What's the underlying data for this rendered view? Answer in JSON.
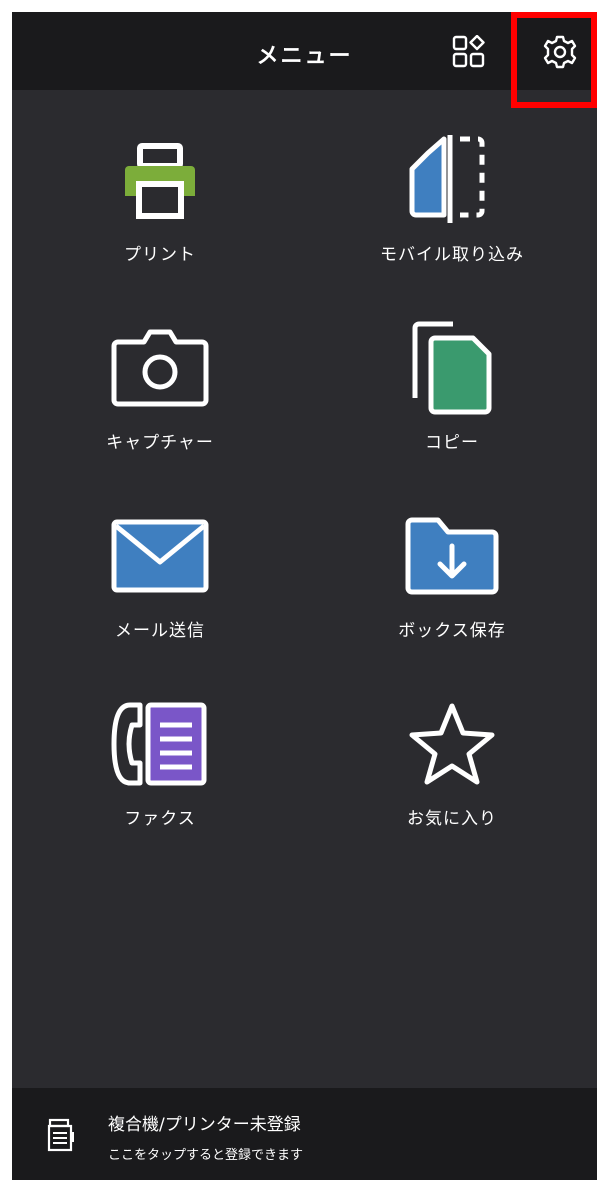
{
  "header": {
    "title": "メニュー",
    "icons": {
      "layout": "grid-shapes-icon",
      "settings": "gear-icon"
    }
  },
  "menu": {
    "items": [
      {
        "label": "プリント",
        "icon": "printer-icon"
      },
      {
        "label": "モバイル取り込み",
        "icon": "mobile-import-icon"
      },
      {
        "label": "キャプチャー",
        "icon": "camera-icon"
      },
      {
        "label": "コピー",
        "icon": "copy-documents-icon"
      },
      {
        "label": "メール送信",
        "icon": "mail-icon"
      },
      {
        "label": "ボックス保存",
        "icon": "box-folder-download-icon"
      },
      {
        "label": "ファクス",
        "icon": "fax-icon"
      },
      {
        "label": "お気に入り",
        "icon": "star-icon"
      }
    ]
  },
  "footer": {
    "title": "複合機/プリンター未登録",
    "subtitle": "ここをタップすると登録できます",
    "icon": "multifunction-printer-icon"
  },
  "colors": {
    "background": "#2b2b2f",
    "bars": "#1a1a1c",
    "highlight": "#ff0000",
    "printer_green": "#7cad3a",
    "blue": "#3f7fc0",
    "copy_green": "#3a9a6e",
    "fax_purple": "#7a56c8"
  }
}
